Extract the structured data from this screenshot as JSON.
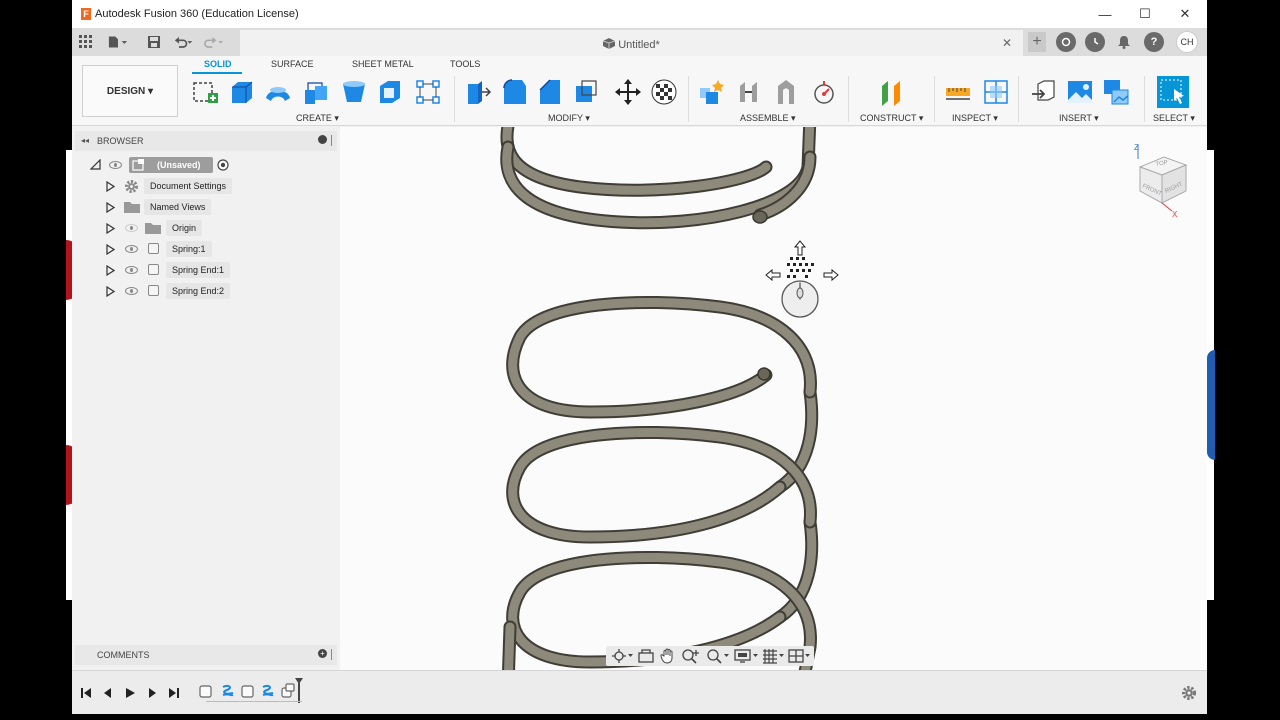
{
  "window": {
    "title": "Autodesk Fusion 360 (Education License)",
    "logo_letter": "F",
    "minimize": "—",
    "maximize": "☐",
    "close": "✕"
  },
  "tabbar": {
    "doc_title": "Untitled*",
    "close_glyph": "✕",
    "add_glyph": "+",
    "avatar": "CH",
    "help_glyph": "?"
  },
  "ribbon": {
    "workspace": "DESIGN ▾",
    "tabs": [
      "SOLID",
      "SURFACE",
      "SHEET METAL",
      "TOOLS"
    ],
    "groups": [
      "CREATE ▾",
      "MODIFY ▾",
      "ASSEMBLE ▾",
      "CONSTRUCT ▾",
      "INSPECT ▾",
      "INSERT ▾",
      "SELECT ▾"
    ]
  },
  "browser": {
    "title": "BROWSER",
    "root": "(Unsaved)",
    "items": [
      {
        "label": "Document Settings",
        "icon": "gear-icon"
      },
      {
        "label": "Named Views",
        "icon": "folder-icon"
      },
      {
        "label": "Origin",
        "icon": "folder-icon"
      },
      {
        "label": "Spring:1",
        "icon": "component-icon"
      },
      {
        "label": "Spring End:1",
        "icon": "component-icon"
      },
      {
        "label": "Spring End:2",
        "icon": "component-icon"
      }
    ]
  },
  "comments": {
    "title": "COMMENTS"
  },
  "viewcube": {
    "top": "TOP",
    "front": "FRONT",
    "right": "RIGHT",
    "z": "Z",
    "x": "X"
  },
  "colors": {
    "accent": "#0696d7",
    "spring": "#8a8676",
    "spring_dark": "#4d4a40"
  }
}
